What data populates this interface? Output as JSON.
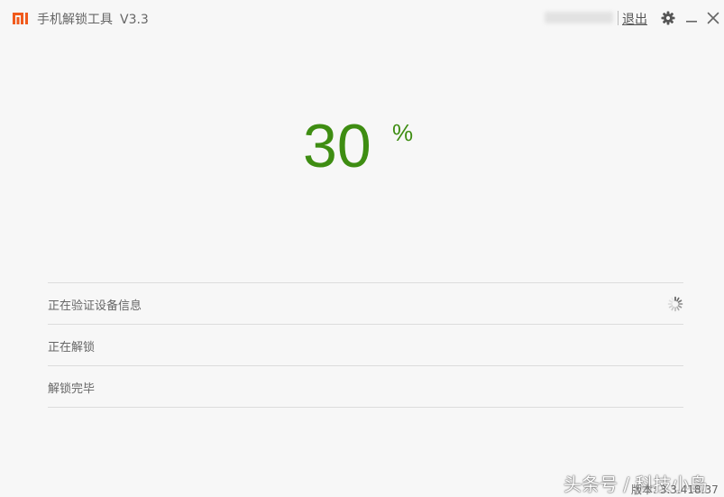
{
  "titlebar": {
    "app_name": "手机解锁工具",
    "version": "V3.3",
    "logout": "退出"
  },
  "progress": {
    "value": "30",
    "unit": "%",
    "color": "#3e8d12"
  },
  "steps": [
    {
      "label": "正在验证设备信息",
      "status": "in-progress"
    },
    {
      "label": "正在解锁",
      "status": "pending"
    },
    {
      "label": "解锁完毕",
      "status": "pending"
    }
  ],
  "footer": {
    "watermark": "头条号 / 科技小岛",
    "version": "版本: 3.3.418.37"
  },
  "colors": {
    "brand": "#f05a1c",
    "accent": "#3e8d12",
    "background": "#f7f7f7"
  },
  "icons": [
    "mi-logo-icon",
    "gear-icon",
    "minimize-icon",
    "close-icon",
    "loading-spinner-icon"
  ]
}
